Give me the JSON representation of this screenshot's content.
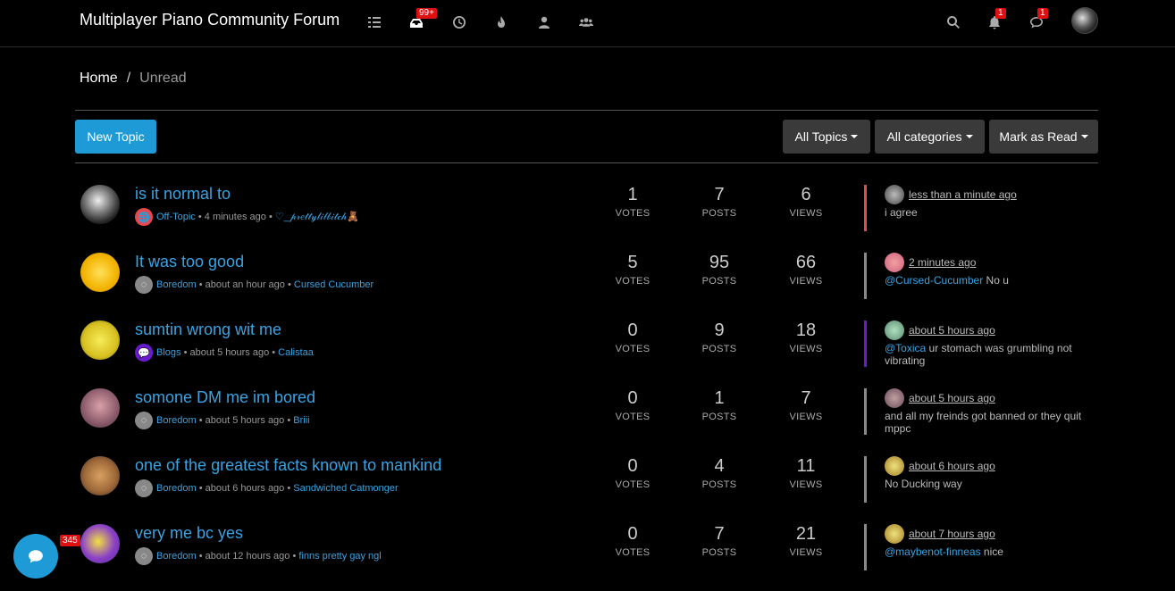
{
  "header": {
    "brand": "Multiplayer Piano Community Forum",
    "nav_icons": [
      "list-icon",
      "inbox-icon",
      "clock-icon",
      "fire-icon",
      "user-icon",
      "users-icon"
    ],
    "unread_badge": "99+",
    "notifications_badge": "1",
    "chats_badge": "1"
  },
  "breadcrumb": {
    "home": "Home",
    "separator": "/",
    "current": "Unread"
  },
  "toolbar": {
    "new_topic": "New Topic",
    "all_topics": "All Topics",
    "all_categories": "All categories",
    "mark_read": "Mark as Read"
  },
  "labels": {
    "votes": "VOTES",
    "posts": "POSTS",
    "views": "VIEWS"
  },
  "topics": [
    {
      "title": "is it normal to",
      "category": "Off-Topic",
      "time": "4 minutes ago",
      "author": "♡_𝓅𝓇𝑒𝓉𝓉𝓎𝓁𝒾𝓁𝒷𝒾𝓉𝒸𝒽🧸",
      "votes": "1",
      "posts": "7",
      "views": "6",
      "lp_time": "less than a minute ago",
      "lp_mention": "",
      "lp_text": "i agree",
      "cat_color": "#e5484d",
      "lp_color": "#e5484d"
    },
    {
      "title": "It was too good",
      "category": "Boredom",
      "time": "about an hour ago",
      "author": "Cursed Cucumber",
      "votes": "5",
      "posts": "95",
      "views": "66",
      "lp_time": "2 minutes ago",
      "lp_mention": "@Cursed-Cucumber",
      "lp_text": " No u",
      "cat_color": "#888",
      "lp_color": "#888"
    },
    {
      "title": "sumtin wrong wit me",
      "category": "Blogs",
      "time": "about 5 hours ago",
      "author": "Calistaa",
      "votes": "0",
      "posts": "9",
      "views": "18",
      "lp_time": "about 5 hours ago",
      "lp_mention": "@Toxica",
      "lp_text": " ur stomach was grumbling not vibrating",
      "cat_color": "#6a1bd1",
      "lp_color": "#6a1bd1"
    },
    {
      "title": "somone DM me im bored",
      "category": "Boredom",
      "time": "about 5 hours ago",
      "author": "Briii",
      "votes": "0",
      "posts": "1",
      "views": "7",
      "lp_time": "about 5 hours ago",
      "lp_mention": "",
      "lp_text": "and all my freinds got banned or they quit mppc",
      "cat_color": "#888",
      "lp_color": "#888"
    },
    {
      "title": "one of the greatest facts known to mankind",
      "category": "Boredom",
      "time": "about 6 hours ago",
      "author": "Sandwiched Catmonger",
      "votes": "0",
      "posts": "4",
      "views": "11",
      "lp_time": "about 6 hours ago",
      "lp_mention": "",
      "lp_text": "No Ducking way",
      "cat_color": "#888",
      "lp_color": "#888"
    },
    {
      "title": "very me bc yes",
      "category": "Boredom",
      "time": "about 12 hours ago",
      "author": "finns pretty gay ngl",
      "votes": "0",
      "posts": "7",
      "views": "21",
      "lp_time": "about 7 hours ago",
      "lp_mention": "@maybenot-finneas",
      "lp_text": " nice",
      "cat_color": "#888",
      "lp_color": "#888"
    }
  ],
  "chat": {
    "badge": "345"
  }
}
